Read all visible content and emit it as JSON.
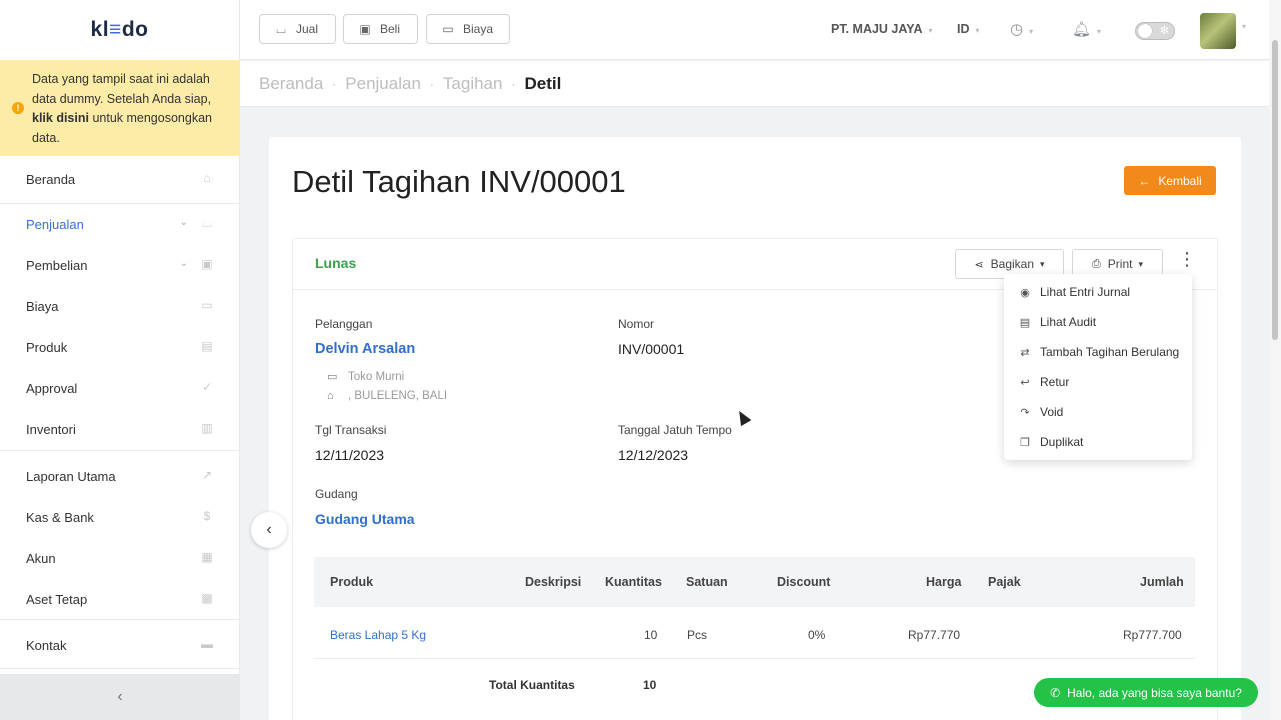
{
  "app": {
    "logo_left": "kl",
    "logo_mid": "≡",
    "logo_right": "do"
  },
  "notice": {
    "text_before": "Data yang tampil saat ini adalah data dummy. Setelah Anda siap, ",
    "link": "klik disini",
    "text_after": " untuk mengosongkan data."
  },
  "sidebar": {
    "items": [
      {
        "label": "Beranda",
        "icon": "home-icon",
        "glyph": "⌂",
        "chevron": false,
        "active": false
      },
      {
        "label": "Penjualan",
        "icon": "basket-icon",
        "glyph": "⌴",
        "chevron": true,
        "active": true
      },
      {
        "label": "Pembelian",
        "icon": "bag-icon",
        "glyph": "▣",
        "chevron": true,
        "active": false
      },
      {
        "label": "Biaya",
        "icon": "card-icon",
        "glyph": "▭",
        "chevron": false,
        "active": false
      },
      {
        "label": "Produk",
        "icon": "box-icon",
        "glyph": "▤",
        "chevron": false,
        "active": false
      },
      {
        "label": "Approval",
        "icon": "check-icon",
        "glyph": "✓",
        "chevron": false,
        "active": false
      },
      {
        "label": "Inventori",
        "icon": "warehouse-icon",
        "glyph": "▥",
        "chevron": false,
        "active": false
      },
      {
        "label": "Laporan Utama",
        "icon": "chart-icon",
        "glyph": "↗",
        "chevron": false,
        "active": false
      },
      {
        "label": "Kas & Bank",
        "icon": "dollar-icon",
        "glyph": "$",
        "chevron": false,
        "active": false
      },
      {
        "label": "Akun",
        "icon": "ledger-icon",
        "glyph": "▦",
        "chevron": false,
        "active": false
      },
      {
        "label": "Aset Tetap",
        "icon": "building-icon",
        "glyph": "▩",
        "chevron": false,
        "active": false
      },
      {
        "label": "Kontak",
        "icon": "contact-card-icon",
        "glyph": "▬",
        "chevron": false,
        "active": false
      }
    ],
    "collapse": "‹"
  },
  "topbar": {
    "jual": "Jual",
    "beli": "Beli",
    "biaya": "Biaya",
    "company": "PT. MAJU JAYA",
    "lang": "ID"
  },
  "breadcrumb": {
    "home": "Beranda",
    "sales": "Penjualan",
    "invoices": "Tagihan",
    "current": "Detil"
  },
  "page": {
    "title": "Detil Tagihan INV/00001",
    "back": "Kembali",
    "status": "Lunas",
    "share": "Bagikan",
    "print": "Print"
  },
  "invoice": {
    "customer_label": "Pelanggan",
    "customer": "Delvin Arsalan",
    "company_name": "Toko Murni",
    "address": ", BULELENG, BALI",
    "number_label": "Nomor",
    "number": "INV/00001",
    "date_label": "Tgl Transaksi",
    "date": "12/11/2023",
    "due_label": "Tanggal Jatuh Tempo",
    "due": "12/12/2023",
    "warehouse_label": "Gudang",
    "warehouse": "Gudang Utama"
  },
  "table": {
    "headers": {
      "product": "Produk",
      "description": "Deskripsi",
      "qty": "Kuantitas",
      "unit": "Satuan",
      "discount": "Discount",
      "price": "Harga",
      "tax": "Pajak",
      "amount": "Jumlah"
    },
    "row": {
      "product": "Beras Lahap 5 Kg",
      "qty": "10",
      "unit": "Pcs",
      "discount": "0%",
      "price": "Rp77.770",
      "amount": "Rp777.700"
    },
    "total_label": "Total Kuantitas",
    "total_qty": "10"
  },
  "menu": {
    "items": [
      {
        "label": "Lihat Entri Jurnal",
        "icon": "eye-icon",
        "glyph": "◉"
      },
      {
        "label": "Lihat Audit",
        "icon": "audit-icon",
        "glyph": "▤"
      },
      {
        "label": "Tambah Tagihan Berulang",
        "icon": "repeat-icon",
        "glyph": "⇄"
      },
      {
        "label": "Retur",
        "icon": "return-icon",
        "glyph": "↩"
      },
      {
        "label": "Void",
        "icon": "void-icon",
        "glyph": "↷"
      },
      {
        "label": "Duplikat",
        "icon": "copy-icon",
        "glyph": "❐"
      }
    ]
  },
  "chat": {
    "label": "Halo, ada yang bisa saya bantu?"
  },
  "colors": {
    "accent": "#3a6fd8",
    "success": "#3aa14a",
    "orange": "#f28a1b",
    "notice": "#fdeba8",
    "chat": "#25c248"
  }
}
